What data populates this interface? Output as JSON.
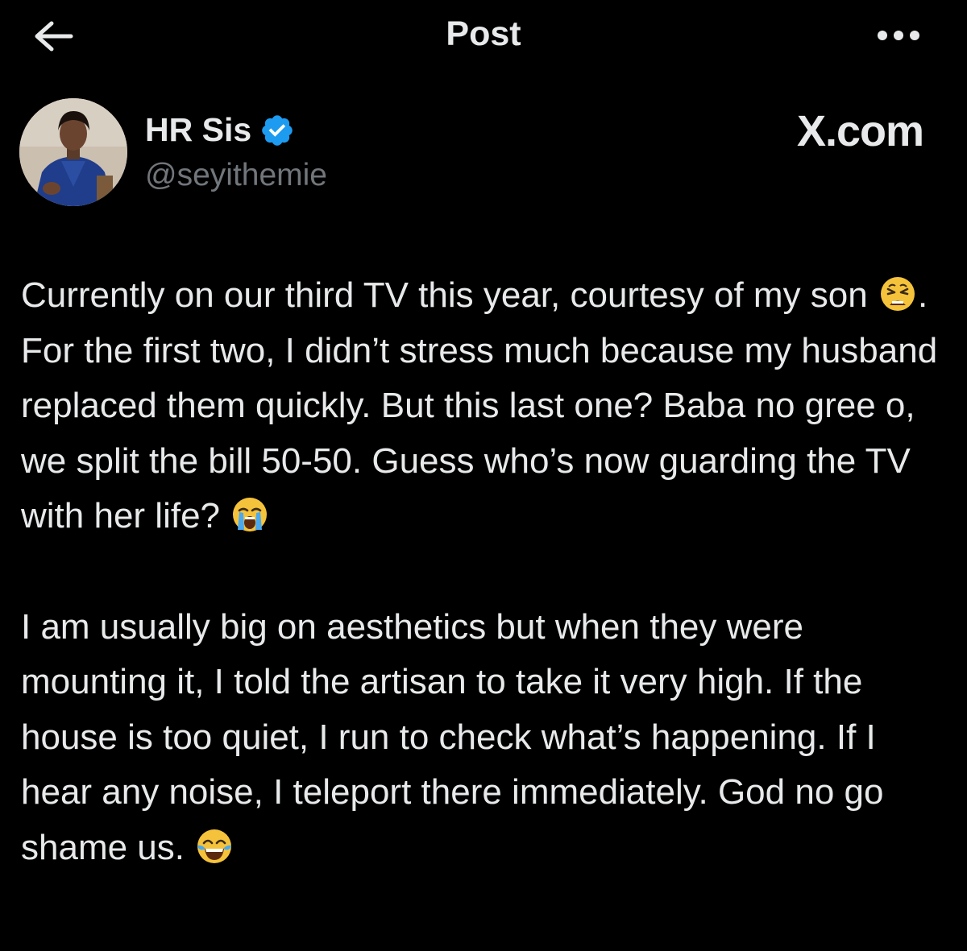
{
  "header": {
    "title": "Post",
    "back_icon": "arrow-left-icon",
    "more_icon": "more-horizontal-icon"
  },
  "author": {
    "display_name": "HR Sis",
    "handle": "@seyithemie",
    "verified_icon": "verified-badge-icon",
    "verified_color": "#1d9bf0",
    "avatar_icon": "avatar-photo"
  },
  "watermark": "X.com",
  "post": {
    "paragraph1": {
      "part1": "Currently on our third TV this year, courtesy of my son ",
      "part2": ". For the first two, I didn’t stress much because my husband replaced them quickly. But this last one? Baba no gree o, we split the bill 50-50. Guess who’s now guarding the TV with her life? ",
      "emoji1": "weary-face-emoji",
      "emoji2": "loudly-crying-face-emoji"
    },
    "paragraph2": {
      "part1": "I am usually big on aesthetics but when they were mounting it, I told the artisan to take it very high. If the house is too quiet, I run to check what’s happening. If I hear any noise, I teleport there immediately. God no go shame us. ",
      "emoji1": "face-with-tears-of-joy-emoji"
    }
  },
  "colors": {
    "background": "#000000",
    "text": "#e7e9ea",
    "secondary_text": "#71767b",
    "accent": "#1d9bf0"
  }
}
